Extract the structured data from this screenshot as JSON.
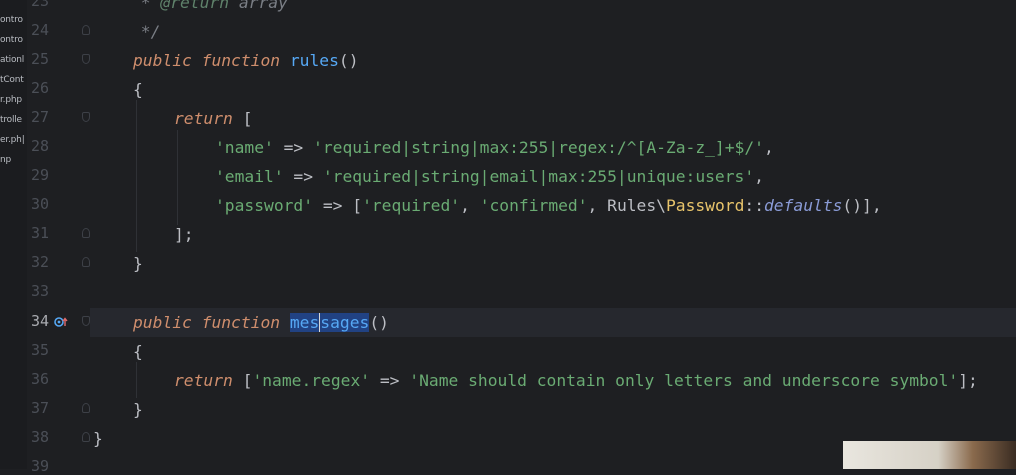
{
  "sidebar": {
    "items": [
      "ontro",
      "ontro",
      "ationl",
      "tCont",
      "r.php",
      "trolle",
      "er.ph|",
      "np"
    ]
  },
  "gutter": {
    "line_numbers": [
      "23",
      "24",
      "25",
      "26",
      "27",
      "28",
      "29",
      "30",
      "31",
      "32",
      "33",
      "34",
      "35",
      "36",
      "37",
      "38",
      "39"
    ],
    "active_line": "34"
  },
  "code": {
    "line23": {
      "comment_star": " * ",
      "tag": "@return",
      "type": " array"
    },
    "line24": {
      "comment_end": " */"
    },
    "line25": {
      "kw_public": "public",
      "kw_function": "function",
      "name": "rules",
      "parens": "()"
    },
    "line26": {
      "brace": "{"
    },
    "line27": {
      "kw_return": "return",
      "bracket": " ["
    },
    "line28": {
      "key": "'name'",
      "arrow": " => ",
      "value": "'required|string|max:255|regex:/^[A-Za-z_]+$/'",
      "comma": ","
    },
    "line29": {
      "key": "'email'",
      "arrow": " => ",
      "value": "'required|string|email|max:255|unique:users'",
      "comma": ","
    },
    "line30": {
      "key": "'password'",
      "arrow": " => ",
      "open": "[",
      "v1": "'required'",
      "sep1": ", ",
      "v2": "'confirmed'",
      "sep2": ", ",
      "ns": "Rules\\",
      "cls": "Password",
      "dc": "::",
      "method": "defaults",
      "close": "()],"
    },
    "line31": {
      "close": "];"
    },
    "line32": {
      "brace": "}"
    },
    "line34": {
      "kw_public": "public",
      "kw_function": "function",
      "name_a": "mes",
      "name_b": "sages",
      "parens": "()"
    },
    "line35": {
      "brace": "{"
    },
    "line36": {
      "kw_return": "return",
      "open": " [",
      "key": "'name.regex'",
      "arrow": " => ",
      "value": "'Name should contain only letters and underscore symbol'",
      "close": "];"
    },
    "line37": {
      "brace": "}"
    },
    "line38": {
      "brace": "}"
    }
  },
  "colors": {
    "background": "#1e1f22",
    "keyword": "#cf8e6d",
    "function": "#56a8f5",
    "string": "#6aab73",
    "class": "#e8c46b",
    "selection": "#214283"
  },
  "icons": {
    "override": "implements-method-icon"
  }
}
